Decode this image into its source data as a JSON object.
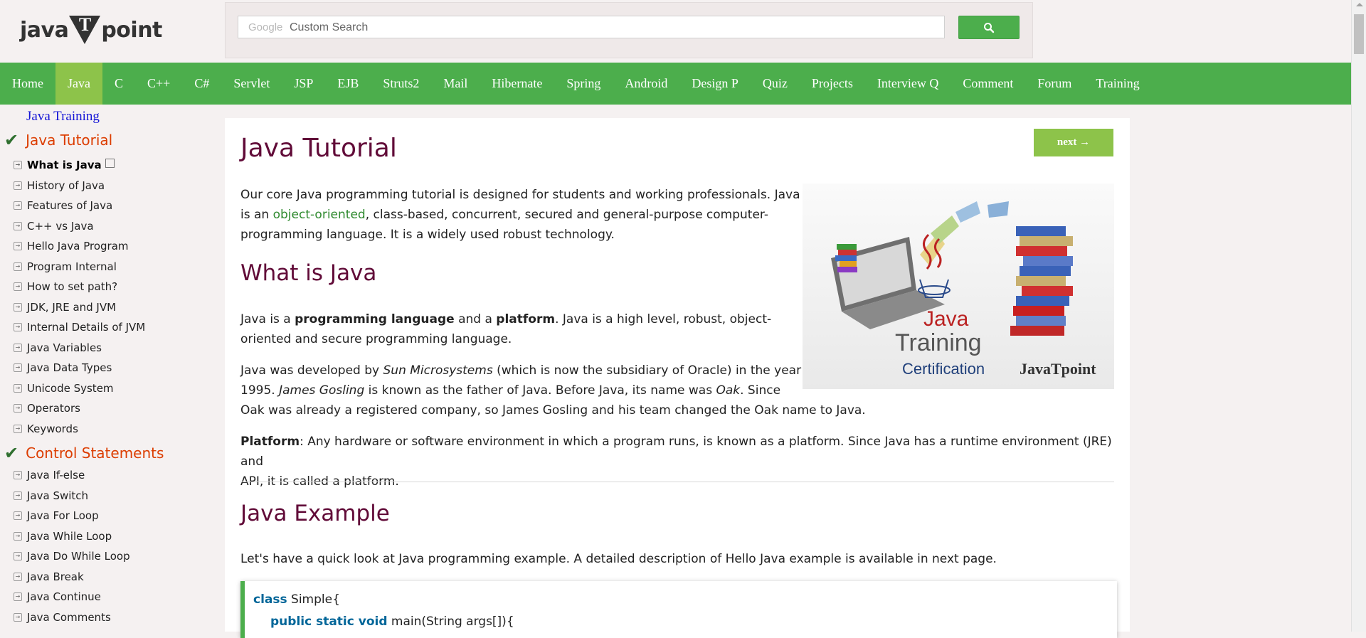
{
  "header": {
    "logo_left": "java",
    "logo_mid": "T",
    "logo_right": "point",
    "search_brand": "Google",
    "search_placeholder": "Custom Search"
  },
  "nav": [
    "Home",
    "Java",
    "C",
    "C++",
    "C#",
    "Servlet",
    "JSP",
    "EJB",
    "Struts2",
    "Mail",
    "Hibernate",
    "Spring",
    "Android",
    "Design P",
    "Quiz",
    "Projects",
    "Interview Q",
    "Comment",
    "Forum",
    "Training"
  ],
  "nav_active": "Java",
  "sidebar": {
    "training_link": "Java Training",
    "section1": "Java Tutorial",
    "items1": [
      "What is Java",
      "History of Java",
      "Features of Java",
      "C++ vs Java",
      "Hello Java Program",
      "Program Internal",
      "How to set path?",
      "JDK, JRE and JVM",
      "Internal Details of JVM",
      "Java Variables",
      "Java Data Types",
      "Unicode System",
      "Operators",
      "Keywords"
    ],
    "section2": "Control Statements",
    "items2": [
      "Java If-else",
      "Java Switch",
      "Java For Loop",
      "Java While Loop",
      "Java Do While Loop",
      "Java Break",
      "Java Continue",
      "Java Comments"
    ]
  },
  "content": {
    "title": "Java Tutorial",
    "next": "next →",
    "intro_a": "Our core Java programming tutorial is designed for students and working professionals. Java",
    "intro_b1": "is an ",
    "intro_link": "object-oriented",
    "intro_b2": ", class-based, concurrent, secured and general-purpose computer-",
    "intro_c": "programming language. It is a widely used robust technology.",
    "h_what": "What is Java",
    "what_a1": "Java is a ",
    "what_b1": "programming language",
    "what_a2": " and a ",
    "what_b2": "platform",
    "what_a3": ". Java is a high level, robust, object-",
    "what_c": "oriented and secure programming language.",
    "dev_1": "Java was developed by ",
    "dev_i1": "Sun Microsystems",
    "dev_2": " (which is now the subsidiary of Oracle) in the year",
    "dev_3": "1995. ",
    "dev_i2": "James Gosling",
    "dev_4": " is known as the father of Java. Before Java, its name was ",
    "dev_i3": "Oak",
    "dev_5": ". Since",
    "dev_6": "Oak was already a registered company, so James Gosling and his team changed the Oak name to Java.",
    "plat_b": "Platform",
    "plat_1": ": Any hardware or software environment in which a program runs, is known as a platform. Since Java has a runtime environment (JRE) and",
    "plat_2": "API, it is called a platform.",
    "h_example": "Java Example",
    "example_text": "Let's have a quick look at Java programming example. A detailed description of Hello Java example is available in next page.",
    "image": {
      "word1": "Java",
      "word2": "Training",
      "word3": "Certification",
      "brand": "JavaTpoint"
    },
    "code": {
      "l1_kw": "class",
      "l1_rest": " Simple{",
      "l2_kw": "public static void",
      "l2_rest": " main(String args[]){"
    }
  },
  "colors": {
    "nav_green": "#4cae4c",
    "nav_active": "#8dc34a",
    "heading": "#610b38",
    "section": "#dc3d00"
  }
}
